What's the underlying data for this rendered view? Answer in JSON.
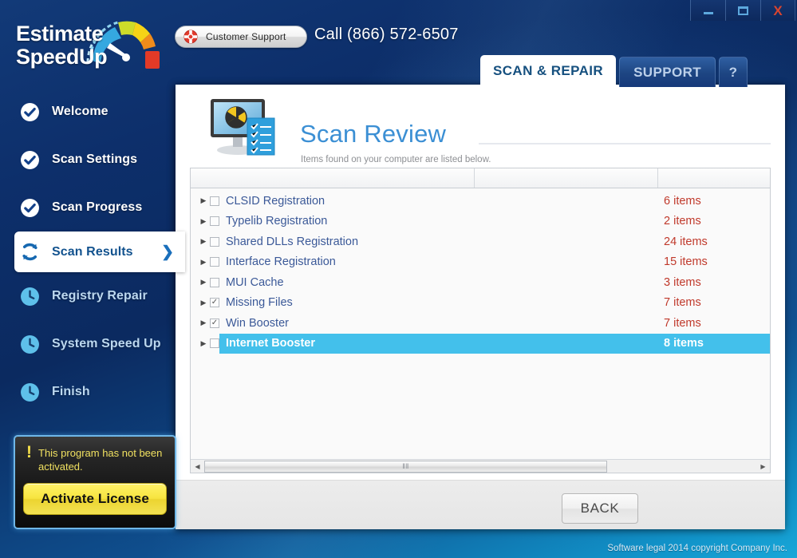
{
  "window": {
    "controls": [
      {
        "name": "minimize",
        "glyph": "minimize-icon"
      },
      {
        "name": "maximize",
        "glyph": "maximize-icon"
      },
      {
        "name": "close",
        "glyph": "close-icon",
        "label": "X"
      }
    ]
  },
  "brand": {
    "line1": "Estimate",
    "line2": "SpeedUp",
    "text": "Estimate\nSpeedUp"
  },
  "header": {
    "support_button_label": "Customer Support",
    "support_icon": "lifebuoy-icon",
    "call_text": "Call  (866) 572-6507"
  },
  "tabs": [
    {
      "label": "SCAN & REPAIR",
      "active": true
    },
    {
      "label": "SUPPORT",
      "active": false
    },
    {
      "label": "?",
      "active": false
    }
  ],
  "sidebar": {
    "items": [
      {
        "label": "Welcome",
        "state": "done",
        "icon": "check-circle-icon"
      },
      {
        "label": "Scan Settings",
        "state": "done",
        "icon": "check-circle-icon"
      },
      {
        "label": "Scan Progress",
        "state": "done",
        "icon": "check-circle-icon"
      },
      {
        "label": "Scan Results",
        "state": "current",
        "icon": "refresh-circle-icon",
        "chevron": "❯"
      },
      {
        "label": "Registry Repair",
        "state": "pending",
        "icon": "clock-circle-icon"
      },
      {
        "label": "System Speed Up",
        "state": "pending",
        "icon": "clock-circle-icon"
      },
      {
        "label": "Finish",
        "state": "pending",
        "icon": "clock-circle-icon"
      }
    ]
  },
  "activation": {
    "warning_icon": "exclamation-icon",
    "message": "This program has not been activated.",
    "button_label": "Activate License"
  },
  "main": {
    "icon": "monitor-radiation-icon",
    "title": "Scan Review",
    "subtitle": "Items found on your computer are listed below.",
    "columns": [
      "",
      "",
      ""
    ],
    "rows": [
      {
        "name": "CLSID Registration",
        "count": "6 items",
        "checked": false,
        "selected": false,
        "expander": "▶"
      },
      {
        "name": "Typelib Registration",
        "count": "2 items",
        "checked": false,
        "selected": false,
        "expander": "▶"
      },
      {
        "name": "Shared DLLs Registration",
        "count": "24 items",
        "checked": false,
        "selected": false,
        "expander": "▶"
      },
      {
        "name": "Interface Registration",
        "count": "15 items",
        "checked": false,
        "selected": false,
        "expander": "▶"
      },
      {
        "name": "MUI Cache",
        "count": "3 items",
        "checked": false,
        "selected": false,
        "expander": "▶"
      },
      {
        "name": "Missing Files",
        "count": "7 items",
        "checked": true,
        "selected": false,
        "expander": "▶"
      },
      {
        "name": "Win Booster",
        "count": "7 items",
        "checked": true,
        "selected": false,
        "expander": "▶"
      },
      {
        "name": "Internet Booster",
        "count": "8 items",
        "checked": false,
        "selected": true,
        "expander": "▶"
      }
    ],
    "scrollbar": {
      "left_arrow": "◀",
      "right_arrow": "▶",
      "grip": "‖‖"
    },
    "back_button_label": "BACK"
  },
  "footer": {
    "legal": "Software legal 2014 copyright   Company Inc."
  },
  "colors": {
    "accent_blue": "#3b8fd4",
    "selection_cyan": "#43c0eb",
    "count_red": "#c0392b",
    "item_blue": "#3b5998",
    "activate_yellow": "#f7e43f"
  }
}
